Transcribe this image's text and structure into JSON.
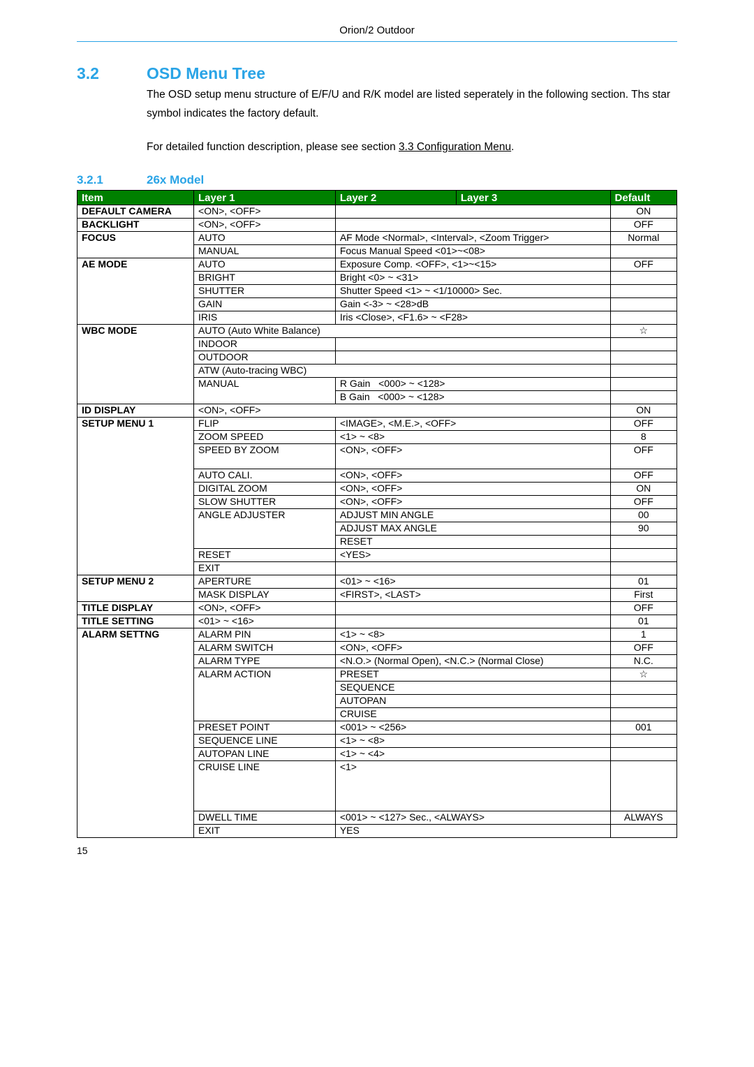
{
  "header": "Orion/2 Outdoor",
  "section": {
    "num": "3.2",
    "title": "OSD Menu Tree"
  },
  "intro1": "The OSD setup menu structure of E/F/U and R/K model are listed seperately in the following section. Ths star symbol indicates the factory default.",
  "intro2a": "For detailed function description, please see section ",
  "intro2b": "3.3 Configuration Menu",
  "intro2c": ".",
  "subsection": {
    "num": "3.2.1",
    "title": "26x Model"
  },
  "th": {
    "item": "Item",
    "l1": "Layer 1",
    "l2": "Layer 2",
    "l3": "Layer 3",
    "def": "Default"
  },
  "r": {
    "defaultcam": {
      "item": "DEFAULT CAMERA",
      "l1": "<ON>, <OFF>",
      "def": "ON"
    },
    "backlight": {
      "item": "BACKLIGHT",
      "l1": "<ON>, <OFF>",
      "def": "OFF"
    },
    "focus": {
      "item": "FOCUS",
      "a": {
        "l1": "AUTO",
        "l2": "AF Mode <Normal>, <Interval>, <Zoom Trigger>",
        "def": "Normal"
      },
      "b": {
        "l1": "MANUAL",
        "l2": "Focus Manual Speed <01>~<08>"
      }
    },
    "ae": {
      "item": "AE MODE",
      "auto": {
        "l1": "AUTO",
        "l2": "Exposure Comp. <OFF>, <1>~<15>",
        "def": "OFF"
      },
      "bright": {
        "l1": "BRIGHT",
        "l2": "Bright <0> ~ <31>"
      },
      "shutter": {
        "l1": "SHUTTER",
        "l2": "Shutter Speed <1> ~ <1/10000> Sec."
      },
      "gain": {
        "l1": "GAIN",
        "l2": "Gain <-3> ~ <28>dB"
      },
      "iris": {
        "l1": "IRIS",
        "l2": "Iris <Close>, <F1.6> ~ <F28>"
      }
    },
    "wbc": {
      "item": "WBC MODE",
      "auto": {
        "l1": "AUTO (Auto White Balance)",
        "def": "☆"
      },
      "indoor": {
        "l1": "INDOOR"
      },
      "outdoor": {
        "l1": "OUTDOOR"
      },
      "atw": {
        "l1": "ATW (Auto-tracing WBC)"
      },
      "manual": {
        "l1": "MANUAL",
        "r": "R Gain   <000> ~ <128>",
        "b": "B Gain   <000> ~ <128>"
      }
    },
    "iddisp": {
      "item": "ID DISPLAY",
      "l1": "<ON>, <OFF>",
      "def": "ON"
    },
    "sm1": {
      "item": "SETUP MENU 1",
      "flip": {
        "l1": "FLIP",
        "l2": "<IMAGE>, <M.E.>, <OFF>",
        "def": "OFF"
      },
      "zoom": {
        "l1": "ZOOM SPEED",
        "l2": "<1> ~ <8>",
        "def": "8"
      },
      "speed": {
        "l1": "SPEED BY ZOOM",
        "l2": "<ON>, <OFF>",
        "def": "OFF"
      },
      "autocali": {
        "l1": "AUTO CALI.",
        "l2": "<ON>, <OFF>",
        "def": "OFF"
      },
      "digzoom": {
        "l1": "DIGITAL ZOOM",
        "l2": "<ON>, <OFF>",
        "def": "ON"
      },
      "slow": {
        "l1": "SLOW SHUTTER",
        "l2": "<ON>, <OFF>",
        "def": "OFF"
      },
      "angle": {
        "l1": "ANGLE ADJUSTER",
        "min": "ADJUST MIN ANGLE",
        "dmin": "00",
        "max": "ADJUST MAX ANGLE",
        "dmax": "90",
        "reset": "RESET"
      },
      "reset": {
        "l1": "RESET",
        "l2": "<YES>"
      },
      "exit": {
        "l1": "EXIT"
      }
    },
    "sm2": {
      "item": "SETUP MENU 2",
      "aperture": {
        "l1": "APERTURE",
        "l2": "<01> ~ <16>",
        "def": "01"
      },
      "mask": {
        "l1": "MASK DISPLAY",
        "l2": "<FIRST>, <LAST>",
        "def": "First"
      }
    },
    "titledisp": {
      "item": "TITLE DISPLAY",
      "l1": "<ON>, <OFF>",
      "def": "OFF"
    },
    "titleset": {
      "item": "TITLE SETTING",
      "l1": "<01> ~ <16>",
      "def": "01"
    },
    "alarm": {
      "item": "ALARM SETTNG",
      "pin": {
        "l1": "ALARM PIN",
        "l2": "<1> ~ <8>",
        "def": "1"
      },
      "switch": {
        "l1": "ALARM SWITCH",
        "l2": "<ON>, <OFF>",
        "def": "OFF"
      },
      "type": {
        "l1": "ALARM TYPE",
        "l2": "<N.O.> (Normal Open), <N.C.> (Normal Close)",
        "def": "N.C."
      },
      "action": {
        "l1": "ALARM ACTION",
        "preset": "PRESET",
        "pdef": "☆",
        "seq": "SEQUENCE",
        "autopan": "AUTOPAN",
        "cruise": "CRUISE"
      },
      "preset": {
        "l1": "PRESET POINT",
        "l2": "<001> ~ <256>",
        "def": "001"
      },
      "seqline": {
        "l1": "SEQUENCE LINE",
        "l2": "<1> ~ <8>"
      },
      "autopanline": {
        "l1": "AUTOPAN LINE",
        "l2": "<1> ~ <4>"
      },
      "cruiseline": {
        "l1": "CRUISE LINE",
        "l2": "<1>"
      },
      "dwell": {
        "l1": "DWELL TIME",
        "l2": "<001> ~ <127> Sec., <ALWAYS>",
        "def": "ALWAYS"
      },
      "exit": {
        "l1": "EXIT",
        "l2": "YES"
      }
    }
  },
  "page": "15"
}
